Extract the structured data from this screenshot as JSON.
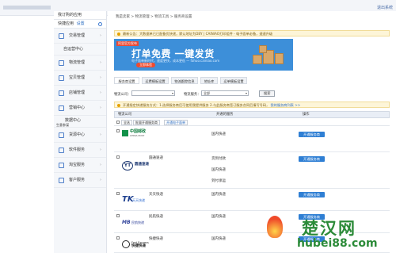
{
  "topbar": {
    "right_label": "退出系统"
  },
  "sidebar": {
    "head": "我订购的应用",
    "shortcut_label": "快捷应用",
    "shortcut_link": "设置",
    "items": [
      {
        "label": "交易管理",
        "icon": "trade-icon"
      },
      {
        "sub": "自运营中心"
      },
      {
        "label": "物流管理",
        "icon": "truck-icon"
      },
      {
        "label": "宝贝管理",
        "icon": "goods-icon"
      },
      {
        "label": "店铺管理",
        "icon": "shop-icon"
      },
      {
        "label": "营销中心",
        "icon": "marketing-icon"
      },
      {
        "sub2": [
          "数据中心",
          "生意参谋"
        ]
      },
      {
        "label": "货源中心",
        "icon": "source-icon"
      },
      {
        "label": "软件服务",
        "icon": "software-icon"
      },
      {
        "label": "淘宝服务",
        "icon": "taobao-icon"
      },
      {
        "label": "客户服务",
        "icon": "customer-icon"
      }
    ]
  },
  "breadcrumb": "我是卖家 > 物流管理 > 物流工具 > 服务商设置",
  "notice": "最新公告：大数据单已已配备优快递，默认地址为DBY | CAINIAO打印组件 - 电子面单必备，速速升级",
  "banner": {
    "label": "阿里官方发布",
    "title": "打单免费 一键发货",
    "subtitle": "电子面单新时代，速度更快，成本更低 — fahuo.cainiao.com",
    "button": "立即体验"
  },
  "tabs": [
    "服务商设置",
    "运费模板设置",
    "物流跟踪信息",
    "地址库",
    "运单模板设置"
  ],
  "filter": {
    "area_label": "物流公司：",
    "area_value": "",
    "service_label": "物流服务：",
    "service_value": "全部",
    "search_button": "搜索"
  },
  "info": {
    "text": "开通指定快递服务方式：1.选择服务商后可使用我提供服务 2.与此服务商签订服务合同后填写号码，",
    "link": "我的服务商列表 >>"
  },
  "table": {
    "headers": [
      "物流公司",
      "开通的服务",
      "操作"
    ],
    "subbar": {
      "select_all": "全选",
      "batch_label": "批量开通服务商",
      "esheet_label": "开通电子面单"
    },
    "rows": [
      {
        "logo_text": "中国邮政",
        "logo_sub": "CHINA POST",
        "services": [
          "国内快递"
        ],
        "button": "开通服务商"
      },
      {
        "logo_text": "圆通速递",
        "logo_mark": "YT",
        "name": "圆通速递",
        "services": [
          "货到付款",
          "国内快递",
          "到付承运"
        ],
        "button": "开通服务商"
      },
      {
        "logo_text": "天天快递",
        "logo_mark": "TK",
        "name": "天天快递",
        "services": [
          "国内快递"
        ],
        "button": "开通服务商"
      },
      {
        "logo_text": "民航快递",
        "logo_mark": "MB",
        "name": "民航快递",
        "services": [
          "国内快递"
        ],
        "button": "开通服务商"
      },
      {
        "logo_text": "快捷快递",
        "logo_sub": "Fast Express",
        "name": "快捷快递",
        "services": [
          "国内快递"
        ],
        "button": "开通服务商"
      }
    ]
  },
  "watermark": {
    "cn": "楚汉网",
    "url": "hubei88.com"
  }
}
